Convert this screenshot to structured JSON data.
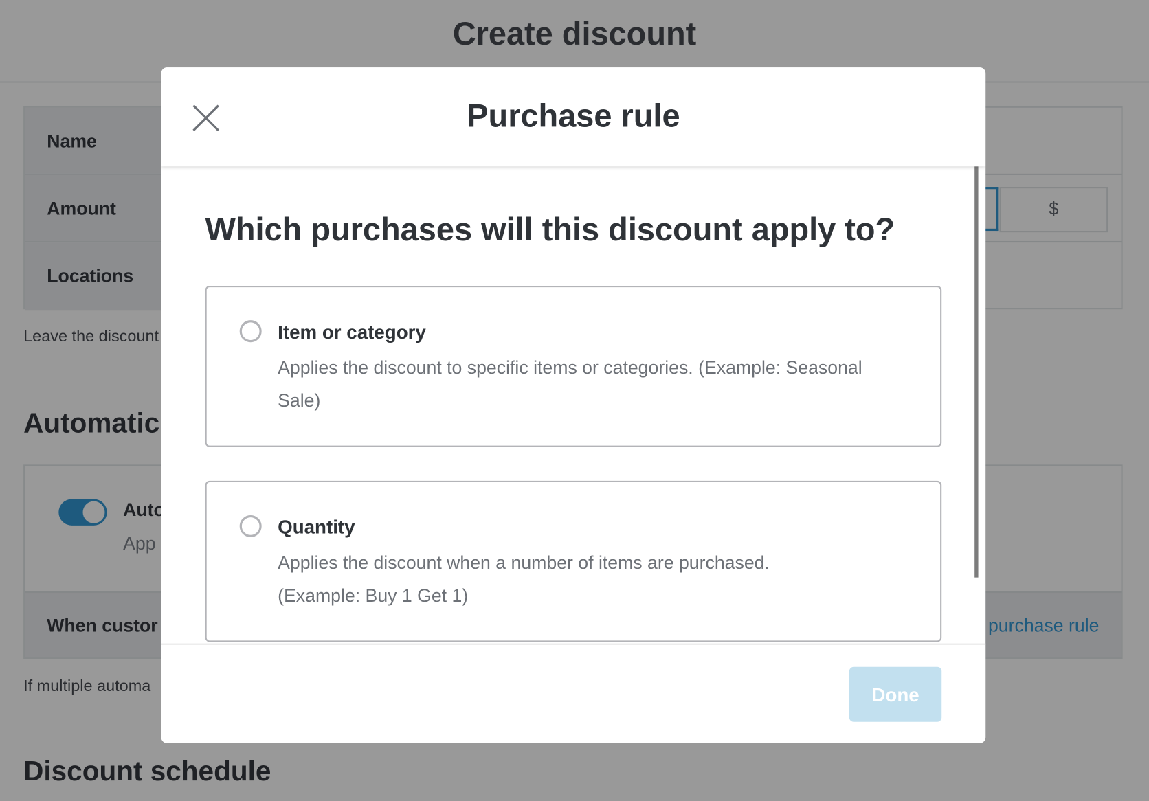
{
  "page": {
    "title": "Create discount",
    "form": {
      "name_label": "Name",
      "amount_label": "Amount",
      "amount_unit": "$",
      "locations_label": "Locations"
    },
    "help_text": "Leave the discount",
    "automatic_section_title": "Automatic",
    "automatic": {
      "toggle_on": true,
      "label": "Auto",
      "sublabel": "App",
      "when_label": "When custor",
      "purchase_rule_link": "purchase rule"
    },
    "multiple_help_text": "If multiple automa",
    "schedule_section_title": "Discount schedule"
  },
  "modal": {
    "title": "Purchase rule",
    "close_icon": "close-x-icon",
    "question": "Which purchases will this discount apply to?",
    "options": [
      {
        "title": "Item or category",
        "description": "Applies the discount to specific items or categories. (Example: Seasonal Sale)",
        "selected": false
      },
      {
        "title": "Quantity",
        "description": "Applies the discount when a number of items are purchased. (Example: Buy 1 Get 1)",
        "selected": false
      }
    ],
    "done_label": "Done",
    "done_enabled": false
  },
  "colors": {
    "accent": "#1e5a7e",
    "done_disabled_bg": "#c2e0ef",
    "overlay_bg": "#999999"
  }
}
